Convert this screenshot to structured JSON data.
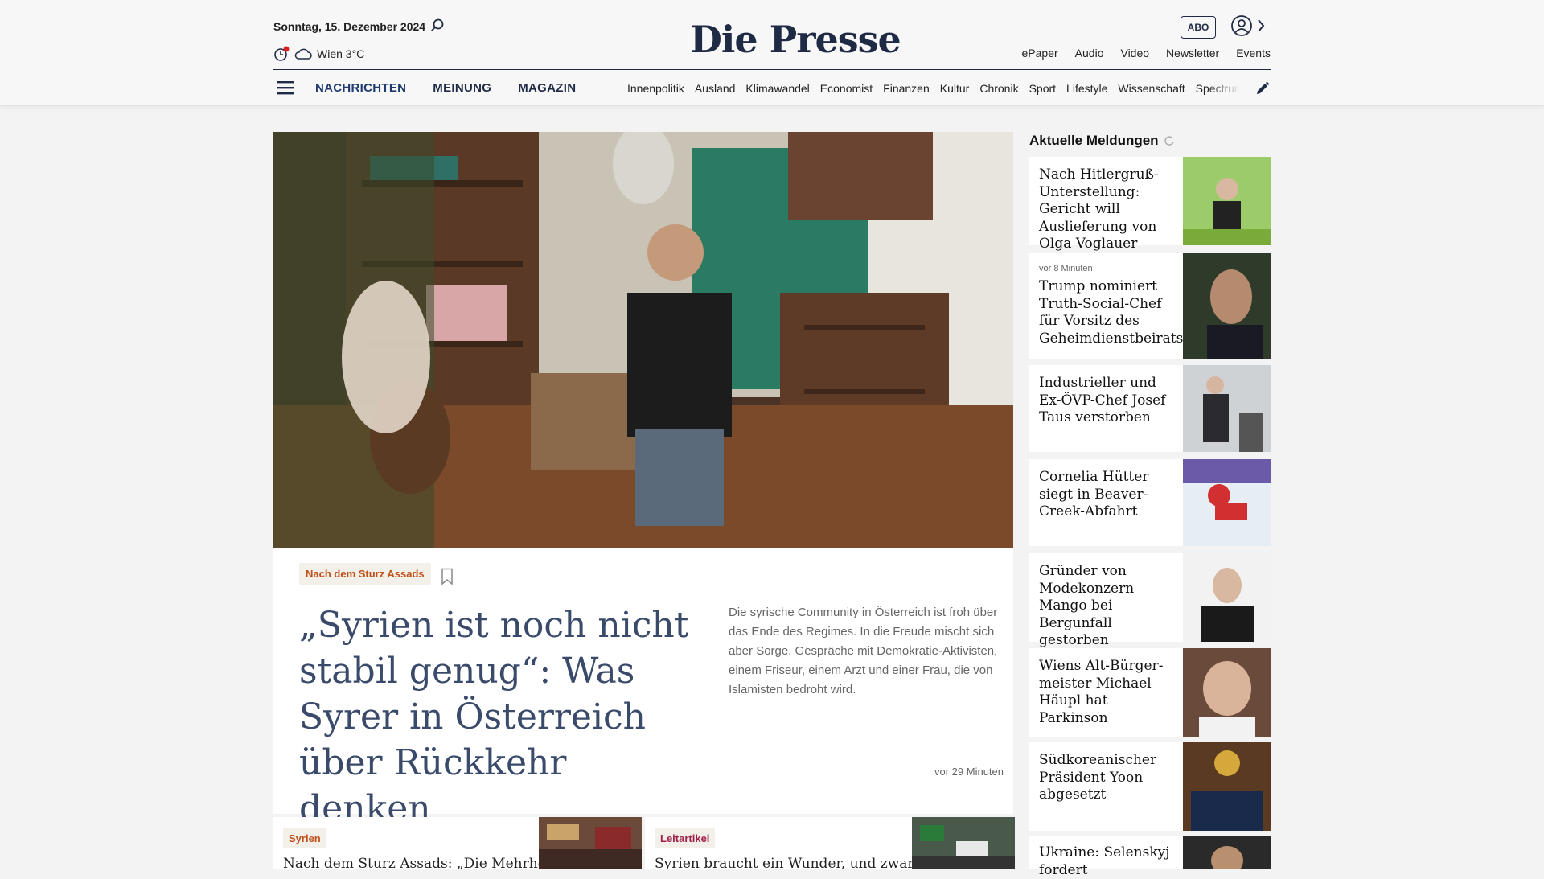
{
  "header": {
    "date": "Sonntag, 15. Dezember 2024",
    "weather": "Wien 3°C",
    "logo": "Die Presse",
    "abo": "ABO",
    "top_links": [
      "ePaper",
      "Audio",
      "Video",
      "Newsletter",
      "Events"
    ],
    "main_nav": [
      "NACHRICHTEN",
      "MEINUNG",
      "MAGAZIN"
    ],
    "sub_nav": [
      "Innenpolitik",
      "Ausland",
      "Klimawandel",
      "Economist",
      "Finanzen",
      "Kultur",
      "Chronik",
      "Sport",
      "Lifestyle",
      "Wissenschaft",
      "Spectrum"
    ]
  },
  "hero": {
    "kicker": "Nach dem Sturz Assads",
    "title": "„Syrien ist noch nicht stabil genug“: Was Syrer in Österreich über Rückkehr denken",
    "teaser": "Die syrische Community in Österreich ist froh über das Ende des Regimes. In die Freude mischt sich aber Sorge. Gespräche mit Demokratie-Aktivisten, einem Friseur, einem Arzt und einer Frau, die von Islamisten bedroht wird.",
    "time": "vor 29 Minuten"
  },
  "cards": [
    {
      "kicker": "Syrien",
      "title": "Nach dem Sturz Assads: „Die Mehrheit"
    },
    {
      "kicker": "Leitartikel",
      "title": "Syrien braucht ein Wunder, und zwar"
    }
  ],
  "aside": {
    "title": "Aktuelle Meldungen",
    "items": [
      {
        "time": "",
        "title": "Nach Hitlergruß-Un­terstellung: Gericht will Auslieferung von Olga Voglauer"
      },
      {
        "time": "vor 8 Minuten",
        "title": "Trump nominiert Truth-Social-Chef für Vorsitz des Geheimdienstbeirats"
      },
      {
        "time": "",
        "title": "Industrieller und Ex-ÖVP-Chef Josef Taus verstorben"
      },
      {
        "time": "",
        "title": "Cornelia Hütter siegt in Beaver-Creek-Abfahrt"
      },
      {
        "time": "",
        "title": "Gründer von Modekonzern Mango bei Bergunfall gestorben"
      },
      {
        "time": "",
        "title": "Wiens Alt-Bürger­meister Michael Häupl hat Parkinson"
      },
      {
        "time": "",
        "title": "Südkoreanischer Präsident Yoon abgesetzt"
      },
      {
        "time": "",
        "title": "Ukraine: Selenskyj fordert"
      }
    ]
  }
}
